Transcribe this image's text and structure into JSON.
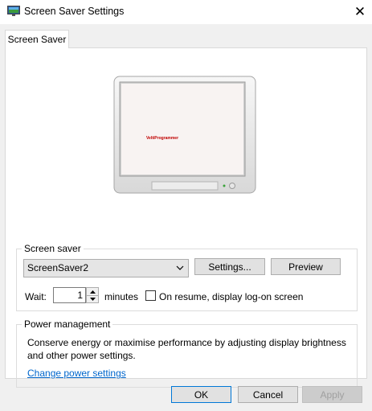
{
  "window": {
    "title": "Screen Saver Settings",
    "close_glyph": "✕",
    "icon": "display-settings-icon"
  },
  "tabs": [
    {
      "label": "Screen Saver",
      "selected": true
    }
  ],
  "preview": {
    "screen_text": "VeltiProgrammer"
  },
  "screen_saver_group": {
    "legend": "Screen saver",
    "selected_saver": "ScreenSaver2",
    "settings_button": "Settings...",
    "preview_button": "Preview",
    "wait_label": "Wait:",
    "wait_value": "1",
    "minutes_label": "minutes",
    "resume_checkbox_label": "On resume, display log-on screen",
    "resume_checked": false
  },
  "power_group": {
    "legend": "Power management",
    "description": "Conserve energy or maximise performance by adjusting display brightness and other power settings.",
    "link": "Change power settings"
  },
  "buttons": {
    "ok": "OK",
    "cancel": "Cancel",
    "apply": "Apply"
  },
  "colors": {
    "accent": "#0078d7",
    "link": "#0066cc",
    "preview_text": "#c00000"
  }
}
